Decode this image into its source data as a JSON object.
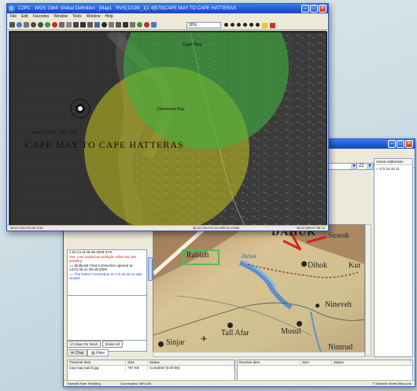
{
  "front_window": {
    "title": "C2PC : WGS 1984: Global Definition : [Map1 : RVS(12180_1[1 4]570)CAPE MAY TO CAPE HATTERAS",
    "menu": [
      "File",
      "Edit",
      "Favorites",
      "Window",
      "Tools",
      "Window",
      "Help"
    ],
    "zoom_value": "30%",
    "map": {
      "title": "CAPE MAY TO CAPE HATTERAS",
      "subtitle": "UNITED STATES - EAST COAST",
      "labels": [
        "Cape May",
        "Delaware Bay"
      ],
      "circle_colors": {
        "green": "#3fb33f",
        "yellow": "#c9c41e"
      }
    },
    "status": {
      "left": "38-04 22N 075-00 37W",
      "middle": "38-04 32N 075-03 40W 51.01NM",
      "right": "38-04 55N 07 5N 13"
    }
  },
  "back_window": {
    "zoom_value": "22",
    "addresses": {
      "header": "Active Addresses",
      "items": [
        "172.16.32.11"
      ]
    },
    "chat": {
      "lines": [
        {
          "text": "1:02:14 at 09-28-2009 SYS",
          "style": "plain"
        },
        {
          "text": "Yes. Last loaded at midnight, other two are pending",
          "style": "red"
        },
        {
          "text": "== Multicast Chat Connection opened at 14:01:28 on 09-28-2009",
          "style": "plain"
        },
        {
          "text": "== The Direct Connection to 172.16.32.11 was closed.",
          "style": "blue"
        }
      ],
      "buttons": [
        "Clear On Send",
        "Erase All"
      ],
      "tabs": [
        "Chat",
        "Files"
      ]
    },
    "map": {
      "labels": [
        "Rabiah",
        "Dahuk",
        "DAHUK",
        "Sirsenk",
        "Kur",
        "Nineveh",
        "Sinjar",
        "Tall Afar",
        "Mosul",
        "Nimrud"
      ]
    },
    "transmit_table": {
      "columns": [
        "Transmit Item",
        "Size",
        "Status"
      ],
      "rows": [
        [
          "iraq-map-patch.jpg",
          "797 KB",
          "Complete [0:00:08]"
        ]
      ]
    },
    "receive_table": {
      "columns": [
        "Receive Item",
        "Size",
        "Status"
      ],
      "rows": []
    },
    "status": {
      "left": "Transmit Rate Throttling",
      "middle": "Coordinates: 36N 42E",
      "right": "© Delorme Street Atlas.com"
    }
  }
}
